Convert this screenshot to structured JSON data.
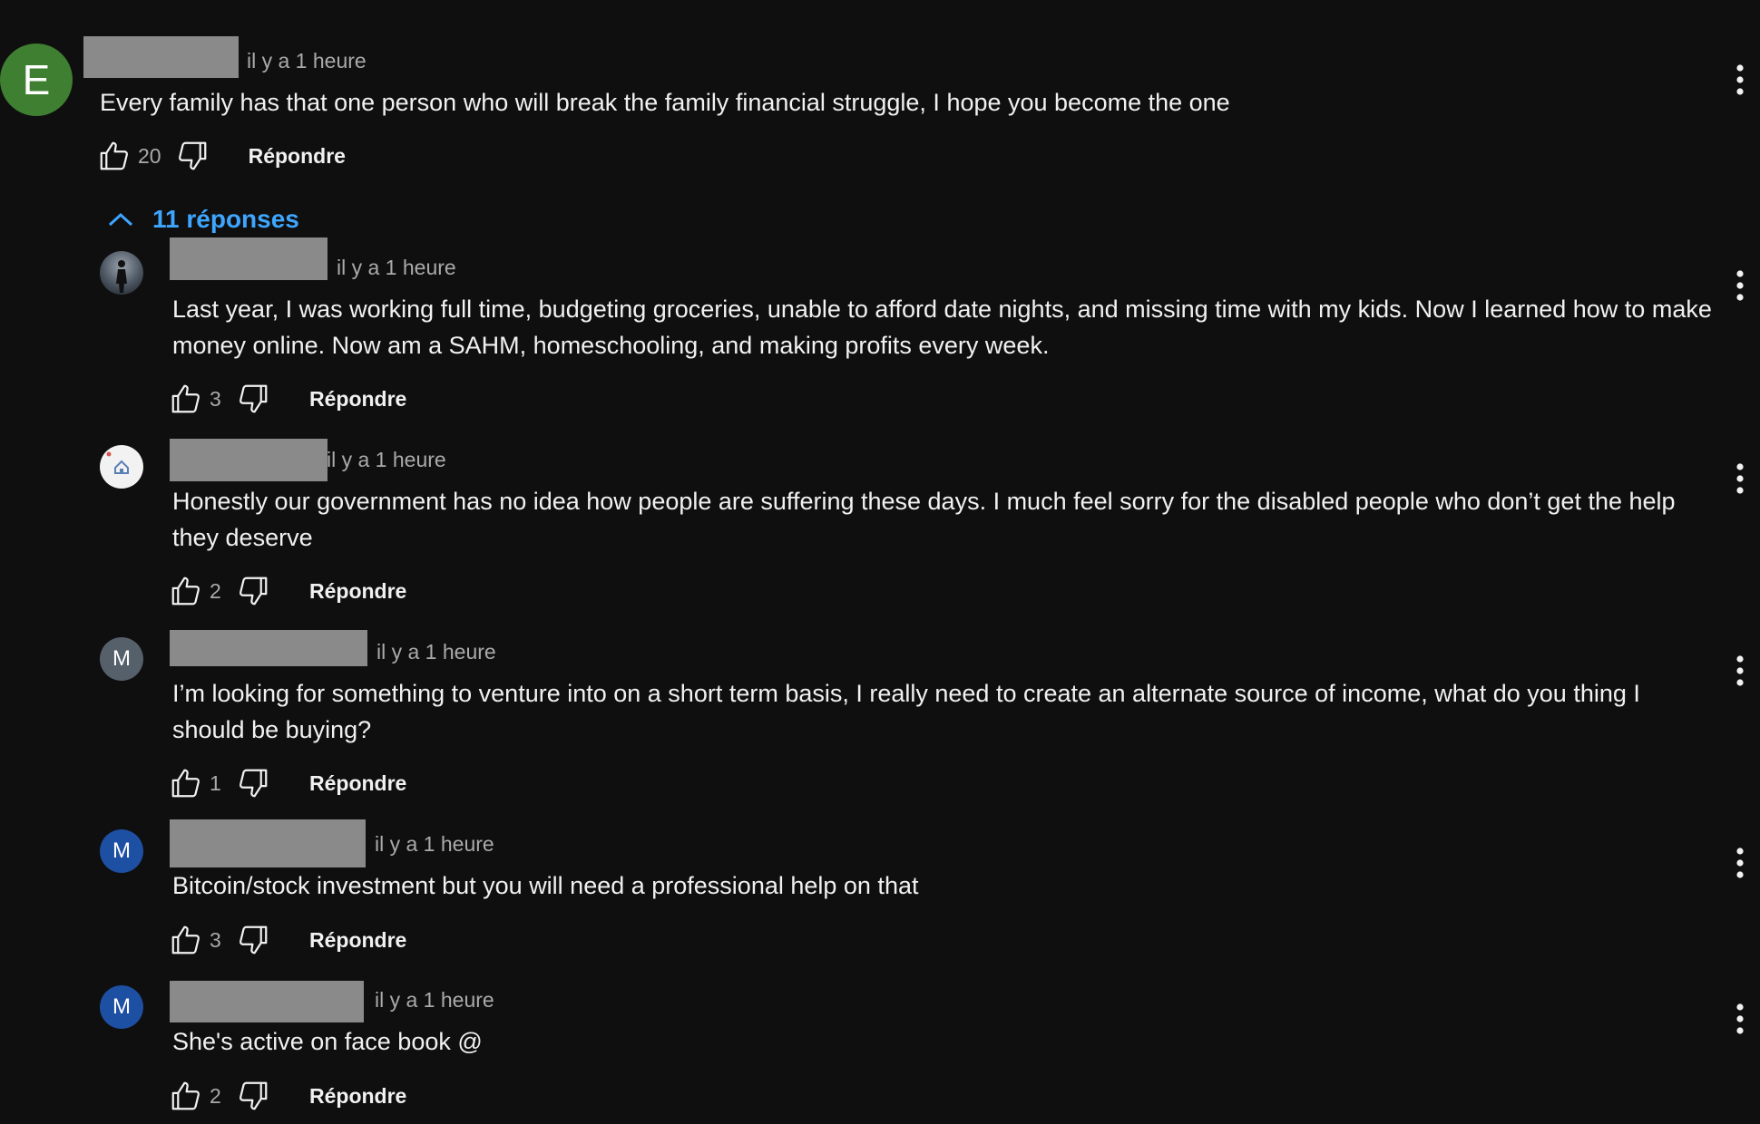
{
  "colors": {
    "background": "#0f0f0f",
    "link": "#3ea6ff",
    "avatar_green": "#3f7f31",
    "avatar_gray": "#56606b",
    "avatar_blue": "#1d4fa3"
  },
  "main_comment": {
    "avatar_letter": "E",
    "time": "il y a 1 heure",
    "text": "Every family has that one person who will break the family financial struggle, I hope you become the one",
    "likes": "20",
    "reply_label": "Répondre",
    "like_icon": "thumb-up-icon",
    "dislike_icon": "thumb-down-icon",
    "menu_icon": "more-vert-icon"
  },
  "replies_toggle": {
    "label": "11 réponses",
    "icon": "chevron-up-icon"
  },
  "replies": [
    {
      "avatar_type": "photo",
      "time": "il y a 1 heure",
      "text": "Last year, I was working full time, budgeting groceries, unable to afford date nights, and missing time with my kids. Now I learned how to make money online. Now am a SAHM, homeschooling, and making profits every week.",
      "likes": "3",
      "reply_label": "Répondre"
    },
    {
      "avatar_type": "house-logo",
      "time": "il y a 1 heure",
      "text": "Honestly our government has no idea how people are suffering these days. I much feel sorry for the disabled people who don’t get the help they deserve",
      "likes": "2",
      "reply_label": "Répondre"
    },
    {
      "avatar_type": "letter",
      "avatar_letter": "M",
      "time": "il y a 1 heure",
      "text": "I’m looking for something to venture into on a short term basis, I really need to create an alternate source of income, what do you thing I should be buying?",
      "likes": "1",
      "reply_label": "Répondre"
    },
    {
      "avatar_type": "letter",
      "avatar_letter": "M",
      "time": "il y a 1 heure",
      "text": "Bitcoin/stock investment but you will need a professional help on that",
      "likes": "3",
      "reply_label": "Répondre"
    },
    {
      "avatar_type": "letter",
      "avatar_letter": "M",
      "time": "il y a 1 heure",
      "text": "She's active on face book @",
      "likes": "2",
      "reply_label": "Répondre"
    }
  ]
}
